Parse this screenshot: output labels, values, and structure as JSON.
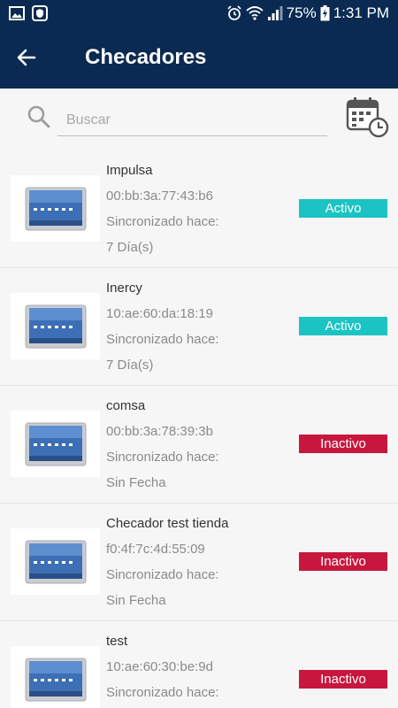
{
  "status_bar": {
    "battery": "75%",
    "time": "1:31 PM"
  },
  "header": {
    "title": "Checadores"
  },
  "search": {
    "placeholder": "Buscar"
  },
  "colors": {
    "active": "#1cc3c3",
    "inactive": "#c8173e",
    "header": "#0a2a52"
  },
  "devices": [
    {
      "name": "Impulsa",
      "mac": "00:bb:3a:77:43:b6",
      "sync_label": "Sincronizado hace:",
      "sync_value": "7 Día(s)",
      "status": "Activo",
      "active": true
    },
    {
      "name": "Inercy",
      "mac": "10:ae:60:da:18:19",
      "sync_label": "Sincronizado hace:",
      "sync_value": "7 Día(s)",
      "status": "Activo",
      "active": true
    },
    {
      "name": "comsa",
      "mac": "00:bb:3a:78:39:3b",
      "sync_label": "Sincronizado hace:",
      "sync_value": "Sin Fecha",
      "status": "Inactivo",
      "active": false
    },
    {
      "name": "Checador test tienda",
      "mac": "f0:4f:7c:4d:55:09",
      "sync_label": "Sincronizado hace:",
      "sync_value": "Sin Fecha",
      "status": "Inactivo",
      "active": false
    },
    {
      "name": "test",
      "mac": "10:ae:60:30:be:9d",
      "sync_label": "Sincronizado hace:",
      "sync_value": "",
      "status": "Inactivo",
      "active": false
    }
  ]
}
